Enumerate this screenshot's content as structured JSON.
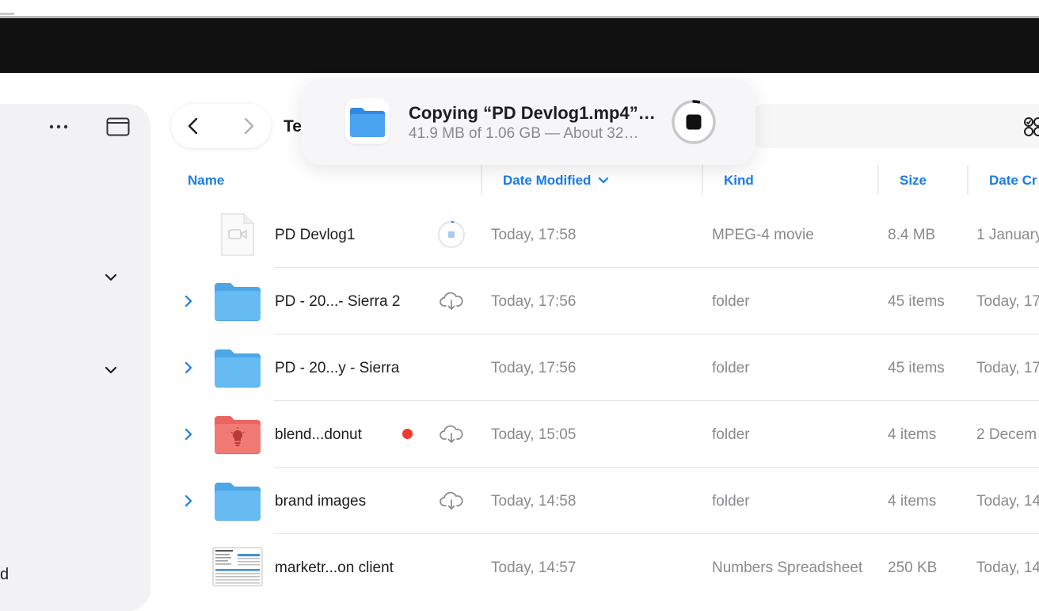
{
  "copy_toast": {
    "title": "Copying “PD Devlog1.mp4”…",
    "progress": "41.9 MB of 1.06 GB — About 32…",
    "progress_fraction": 0.04
  },
  "window": {
    "title_fragment": "Te"
  },
  "sidebar": {
    "bottom_text": "d"
  },
  "columns": {
    "name": "Name",
    "date_modified": "Date Modified",
    "kind": "Kind",
    "size": "Size",
    "date_created": "Date Cr"
  },
  "rows": [
    {
      "name": "PD Devlog1",
      "date": "Today, 17:58",
      "kind": "MPEG-4 movie",
      "size": "8.4 MB",
      "created": "1 January"
    },
    {
      "name": "PD - 20...- Sierra 2",
      "date": "Today, 17:56",
      "kind": "folder",
      "size": "45 items",
      "created": "Today, 17"
    },
    {
      "name": "PD - 20...y - Sierra",
      "date": "Today, 17:56",
      "kind": "folder",
      "size": "45 items",
      "created": "Today, 17"
    },
    {
      "name": "blend...donut",
      "date": "Today, 15:05",
      "kind": "folder",
      "size": "4 items",
      "created": "2 Decem",
      "tag_color": "#f03a2f"
    },
    {
      "name": "brand images",
      "date": "Today, 14:58",
      "kind": "folder",
      "size": "4 items",
      "created": "Today, 14"
    },
    {
      "name": "marketr...on client",
      "date": "Today, 14:57",
      "kind": "Numbers Spreadsheet",
      "size": "250 KB",
      "created": "Today, 14"
    }
  ],
  "icons": {
    "sidebar_more": "ellipsis-icon",
    "sidebar_toggle": "sidebar-toggle-icon",
    "back": "chevron-left-icon",
    "forward": "chevron-right-icon",
    "view_options": "view-options-icon",
    "cloud": "cloud-download-icon",
    "stop": "stop-icon"
  },
  "colors": {
    "accent": "#1a7ce6",
    "folder_blue": "#5cb4ee",
    "folder_red": "#f27a74",
    "tag_red": "#f03a2f"
  }
}
